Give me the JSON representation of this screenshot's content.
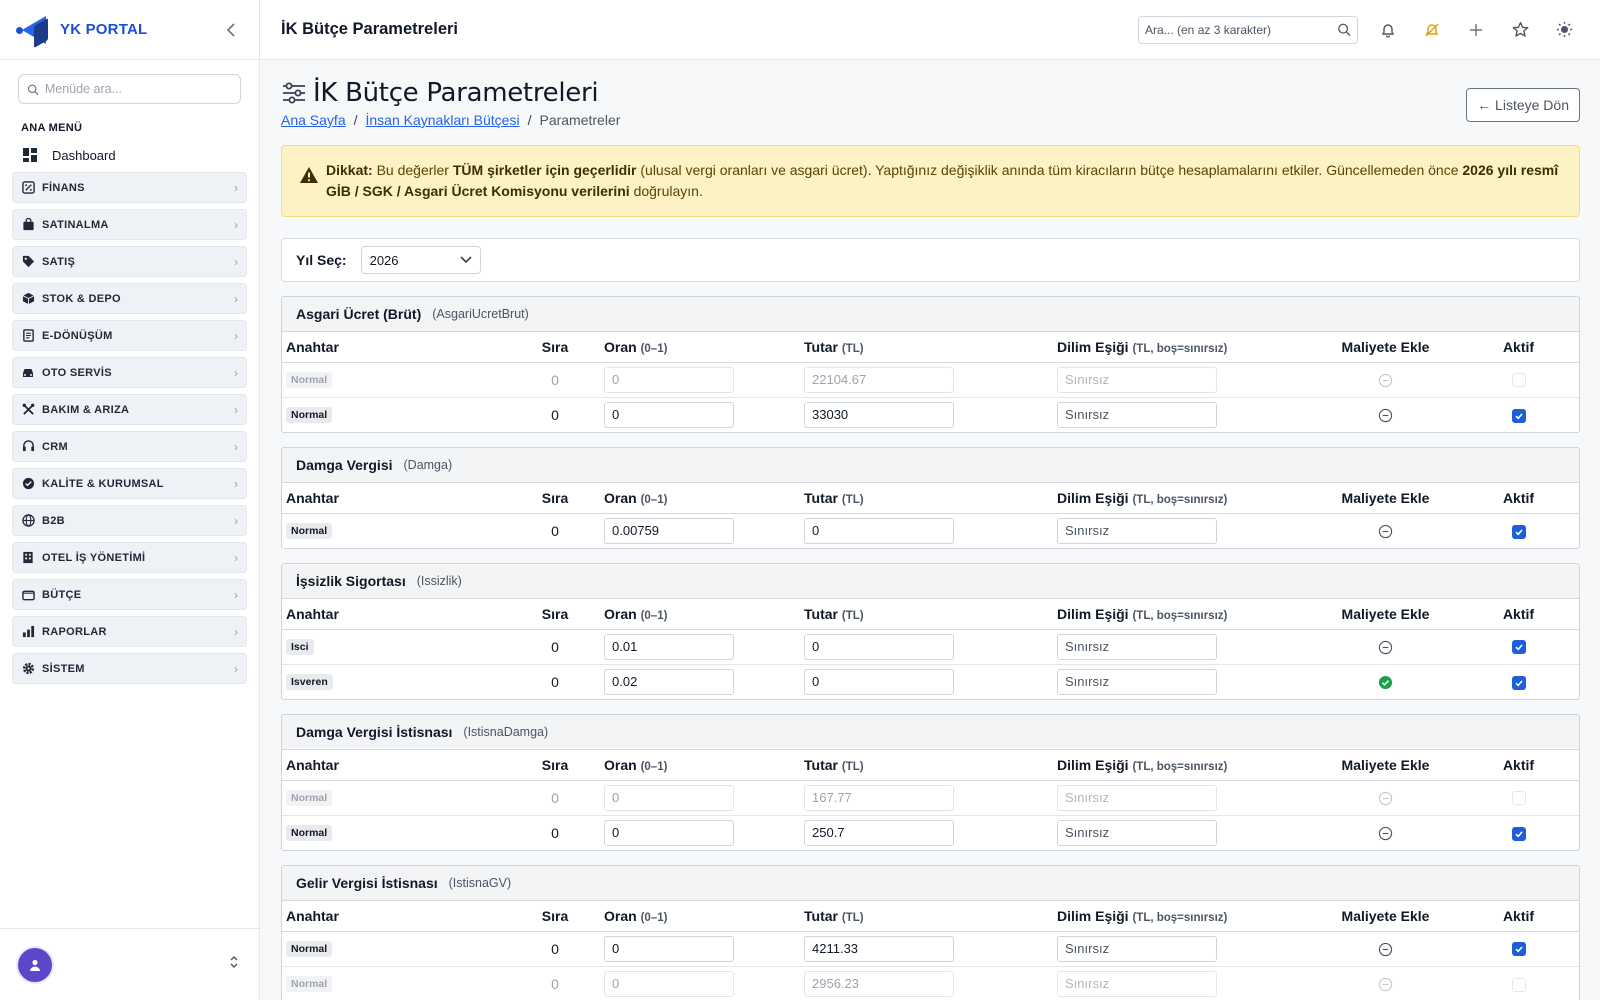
{
  "brand": {
    "name": "YK PORTAL"
  },
  "sidebar": {
    "search_placeholder": "Menüde ara...",
    "section_title": "ANA MENÜ",
    "dashboard": "Dashboard",
    "items": [
      {
        "label": "FİNANS",
        "icon": "percent-icon"
      },
      {
        "label": "SATINALMA",
        "icon": "bag-icon"
      },
      {
        "label": "SATIŞ",
        "icon": "tag-icon"
      },
      {
        "label": "STOK & DEPO",
        "icon": "box-icon"
      },
      {
        "label": "E-DÖNÜŞÜM",
        "icon": "document-icon"
      },
      {
        "label": "OTO SERVİS",
        "icon": "car-icon"
      },
      {
        "label": "BAKIM & ARIZA",
        "icon": "tools-icon"
      },
      {
        "label": "CRM",
        "icon": "headset-icon"
      },
      {
        "label": "KALİTE & KURUMSAL",
        "icon": "badge-check-icon"
      },
      {
        "label": "B2B",
        "icon": "globe-icon"
      },
      {
        "label": "OTEL İŞ YÖNETİMİ",
        "icon": "building-icon"
      },
      {
        "label": "BÜTÇE",
        "icon": "wallet-icon"
      },
      {
        "label": "RAPORLAR",
        "icon": "bar-chart-icon"
      },
      {
        "label": "SİSTEM",
        "icon": "gear-icon"
      }
    ]
  },
  "topbar": {
    "title": "İK Bütçe Parametreleri",
    "search_placeholder": "Ara... (en az 3 karakter)"
  },
  "page": {
    "title": "İK Bütçe Parametreleri",
    "back_label": "← Listeye Dön",
    "breadcrumb": {
      "home": "Ana Sayfa",
      "parent": "İnsan Kaynakları Bütçesi",
      "current": "Parametreler"
    }
  },
  "alert": {
    "prefix": "Dikkat:",
    "t1": " Bu değerler ",
    "b1": "TÜM şirketler için geçerlidir",
    "t2": " (ulusal vergi oranları ve asgari ücret). Yaptığınız değişiklik anında tüm kiracıların bütçe hesaplamalarını etkiler. Güncellemeden önce ",
    "b2": "2026 yılı resmî GİB / SGK / Asgari Ücret Komisyonu verilerini",
    "t3": " doğrulayın."
  },
  "year": {
    "label": "Yıl Seç:",
    "value": "2026"
  },
  "columns": {
    "key": "Anahtar",
    "order": "Sıra",
    "rate": "Oran",
    "rate_unit": "(0–1)",
    "amount": "Tutar",
    "amount_unit": "(TL)",
    "bracket": "Dilim Eşiği",
    "bracket_unit": "(TL, boş=sınırsız)",
    "cost": "Maliyete Ekle",
    "active": "Aktif"
  },
  "bracket_placeholder": "Sınırsız",
  "sections": [
    {
      "title": "Asgari Ücret (Brüt)",
      "key": "(AsgariUcretBrut)",
      "rows": [
        {
          "badge": "Normal",
          "order": "0",
          "rate": "0",
          "amount": "22104.67",
          "inactive": true,
          "cost": false,
          "active": false
        },
        {
          "badge": "Normal",
          "order": "0",
          "rate": "0",
          "amount": "33030",
          "inactive": false,
          "cost": false,
          "active": true
        }
      ]
    },
    {
      "title": "Damga Vergisi",
      "key": "(Damga)",
      "rows": [
        {
          "badge": "Normal",
          "order": "0",
          "rate": "0.00759",
          "amount": "0",
          "inactive": false,
          "cost": false,
          "active": true
        }
      ]
    },
    {
      "title": "İşsizlik Sigortası",
      "key": "(Issizlik)",
      "rows": [
        {
          "badge": "Isci",
          "order": "0",
          "rate": "0.01",
          "amount": "0",
          "inactive": false,
          "cost": false,
          "active": true
        },
        {
          "badge": "Isveren",
          "order": "0",
          "rate": "0.02",
          "amount": "0",
          "inactive": false,
          "cost": true,
          "active": true
        }
      ]
    },
    {
      "title": "Damga Vergisi İstisnası",
      "key": "(IstisnaDamga)",
      "rows": [
        {
          "badge": "Normal",
          "order": "0",
          "rate": "0",
          "amount": "167.77",
          "inactive": true,
          "cost": false,
          "active": false
        },
        {
          "badge": "Normal",
          "order": "0",
          "rate": "0",
          "amount": "250.7",
          "inactive": false,
          "cost": false,
          "active": true
        }
      ]
    },
    {
      "title": "Gelir Vergisi İstisnası",
      "key": "(IstisnaGV)",
      "rows": [
        {
          "badge": "Normal",
          "order": "0",
          "rate": "0",
          "amount": "4211.33",
          "inactive": false,
          "cost": false,
          "active": true
        },
        {
          "badge": "Normal",
          "order": "0",
          "rate": "0",
          "amount": "2956.23",
          "inactive": true,
          "cost": false,
          "active": false
        }
      ]
    }
  ],
  "colors": {
    "accent": "#1d5fd6",
    "link": "#2563eb",
    "success": "#1e9e4a",
    "alert_bg": "#fdf2c4",
    "avatar": "#5b47c9"
  }
}
